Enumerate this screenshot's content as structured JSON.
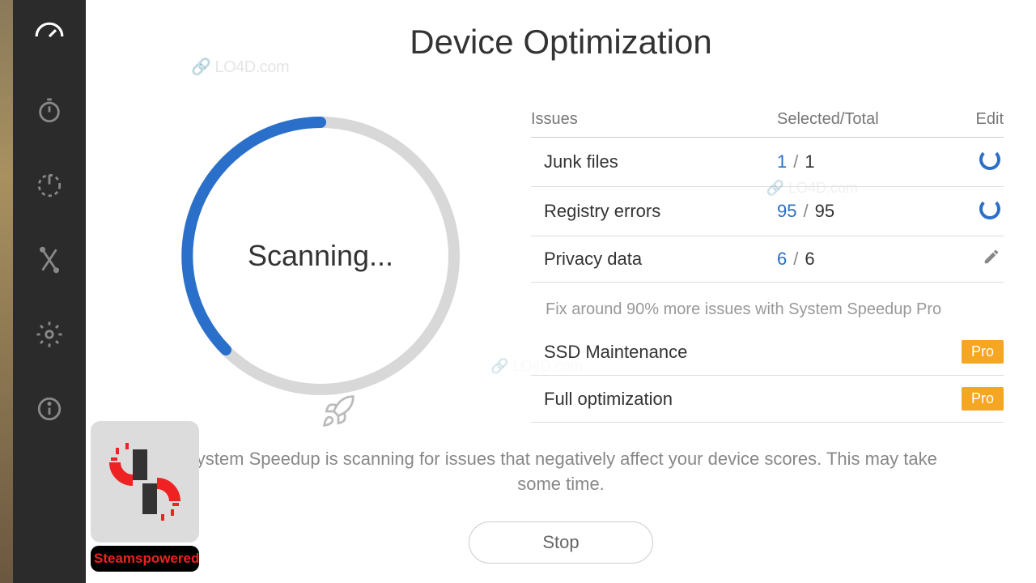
{
  "title": "Device Optimization",
  "scan_status": "Scanning...",
  "headers": {
    "issues": "Issues",
    "selected": "Selected/Total",
    "edit": "Edit"
  },
  "rows": [
    {
      "label": "Junk files",
      "selected": "1",
      "total": "1",
      "action": "spinner"
    },
    {
      "label": "Registry errors",
      "selected": "95",
      "total": "95",
      "action": "spinner"
    },
    {
      "label": "Privacy data",
      "selected": "6",
      "total": "6",
      "action": "pencil"
    }
  ],
  "promo_text": "Fix around 90% more issues with System Speedup Pro",
  "pro_rows": [
    {
      "label": "SSD Maintenance",
      "badge": "Pro"
    },
    {
      "label": "Full optimization",
      "badge": "Pro"
    }
  ],
  "status_text": "System Speedup is scanning for issues that negatively affect your device scores. This may take some time.",
  "stop_button": "Stop",
  "logo_label": "Steamspowered",
  "watermark": "LO4D.com"
}
